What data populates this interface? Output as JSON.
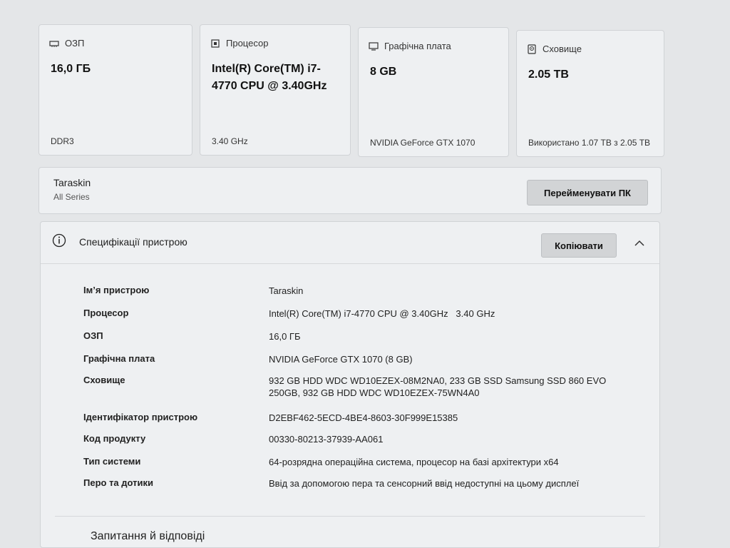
{
  "cards": {
    "ram": {
      "title": "ОЗП",
      "value": "16,0 ГБ",
      "sub": "DDR3",
      "icon": "memory-icon"
    },
    "cpu": {
      "title": "Процесор",
      "value": "Intel(R) Core(TM) i7-4770 CPU @ 3.40GHz",
      "sub": "3.40 GHz",
      "icon": "processor-icon"
    },
    "gpu": {
      "title": "Графічна плата",
      "value": "8 GB",
      "sub": "NVIDIA GeForce GTX 1070",
      "icon": "display-icon"
    },
    "storage": {
      "title": "Сховище",
      "value": "2.05 TB",
      "sub": "Використано 1.07 TB з 2.05 TB",
      "icon": "storage-icon"
    }
  },
  "device": {
    "name": "Taraskin",
    "model": "All Series",
    "rename_label": "Перейменувати ПК"
  },
  "specs": {
    "title": "Специфікації пристрою",
    "copy_label": "Копіювати",
    "rows": [
      {
        "label": "Ім’я пристрою",
        "value": "Taraskin"
      },
      {
        "label": "Процесор",
        "value": "Intel(R) Core(TM) i7-4770 CPU @ 3.40GHz   3.40 GHz"
      },
      {
        "label": "ОЗП",
        "value": "16,0 ГБ"
      },
      {
        "label": "Графічна плата",
        "value": "NVIDIA GeForce GTX 1070 (8 GB)"
      },
      {
        "label": "Сховище",
        "value": "932 GB HDD WDC WD10EZEX-08M2NA0, 233 GB SSD Samsung SSD 860 EVO 250GB, 932 GB HDD WDC WD10EZEX-75WN4A0"
      },
      {
        "label": "Ідентифікатор пристрою",
        "value": "D2EBF462-5ECD-4BE4-8603-30F999E15385"
      },
      {
        "label": "Код продукту",
        "value": "00330-80213-37939-AA061"
      },
      {
        "label": "Тип системи",
        "value": "64-розрядна операційна система, процесор на базі архітектури x64"
      },
      {
        "label": "Перо та дотики",
        "value": "Ввід за допомогою пера та сенсорний ввід недоступні на цьому дисплеї"
      }
    ]
  },
  "faq": {
    "title": "Запитання й відповіді"
  }
}
